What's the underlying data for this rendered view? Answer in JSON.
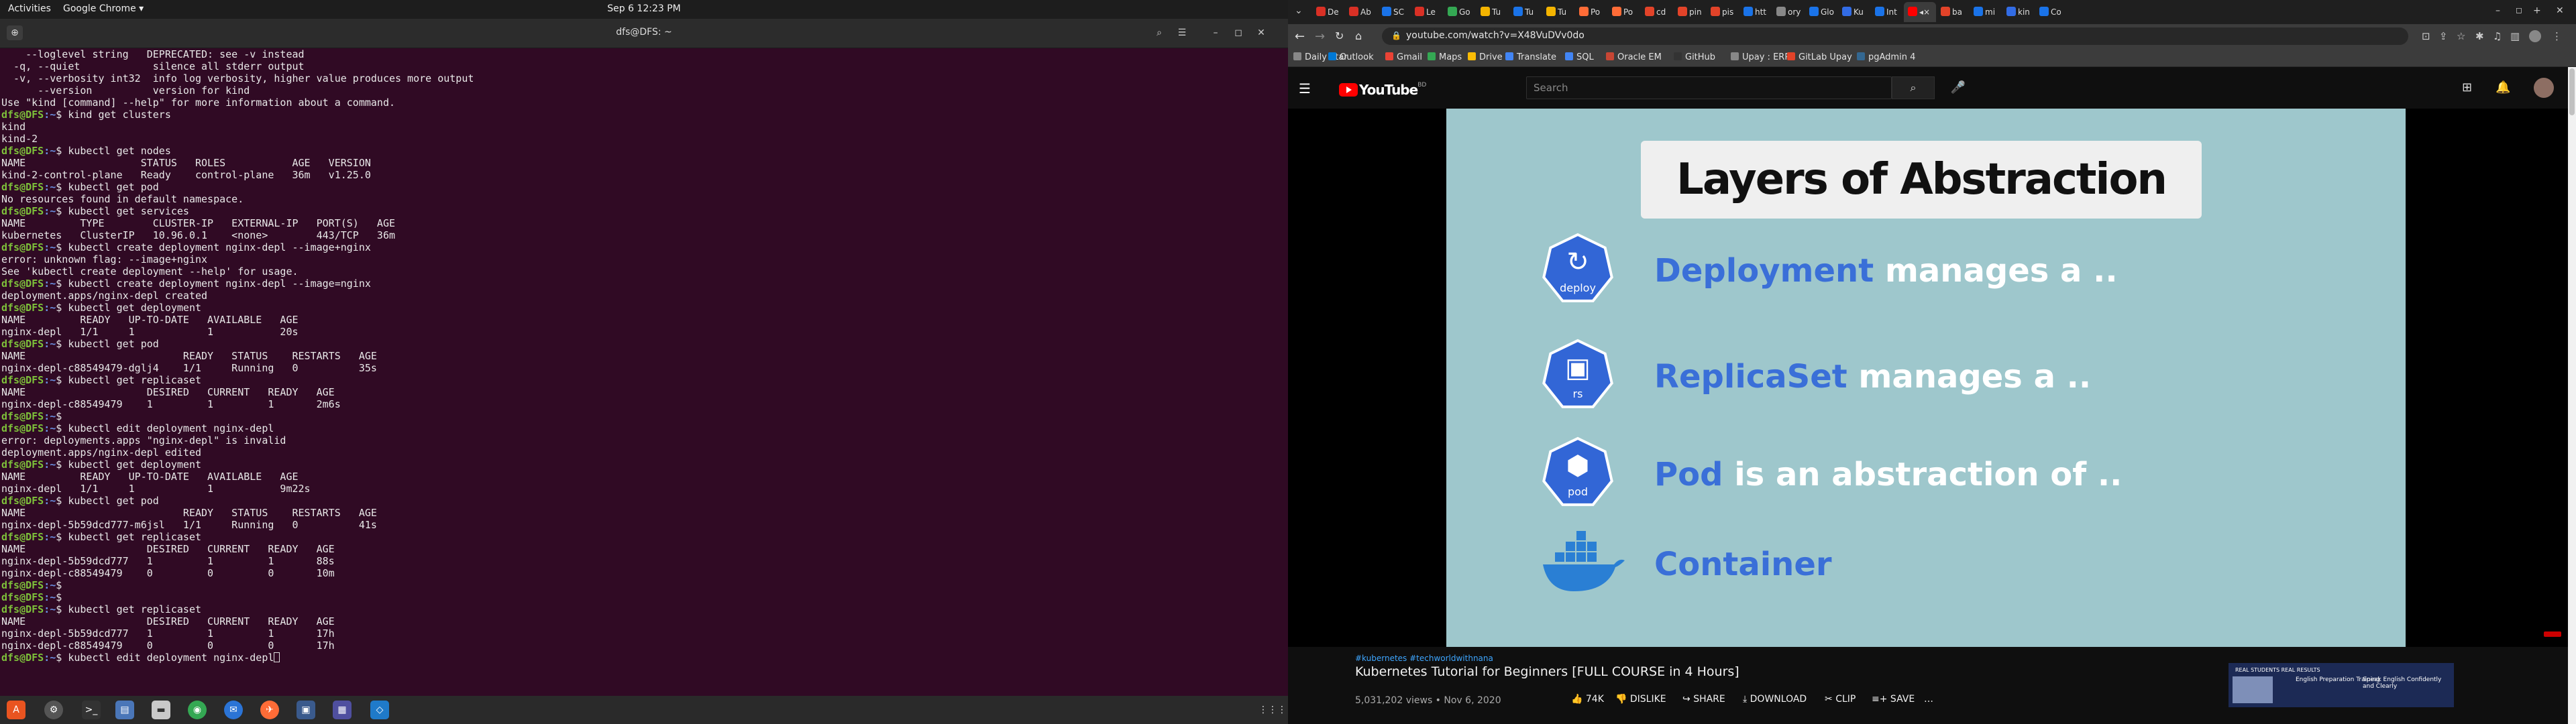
{
  "topbar": {
    "activities": "Activities",
    "app_menu": "Google Chrome ▾",
    "clock": "Sep 6  12:23 PM"
  },
  "terminal": {
    "title": "dfs@DFS: ~",
    "lines": [
      {
        "t": "    --loglevel string   DEPRECATED: see -v instead"
      },
      {
        "t": "  -q, --quiet            silence all stderr output"
      },
      {
        "t": "  -v, --verbosity int32  info log verbosity, higher value produces more output"
      },
      {
        "t": "      --version          version for kind"
      },
      {
        "t": ""
      },
      {
        "t": "Use \"kind [command] --help\" for more information about a command."
      },
      {
        "p": "dfs@DFS",
        "d": ":~",
        "c": "$ kind get clusters"
      },
      {
        "t": "kind"
      },
      {
        "t": "kind-2"
      },
      {
        "p": "dfs@DFS",
        "d": ":~",
        "c": "$ kubectl get nodes"
      },
      {
        "t": "NAME                   STATUS   ROLES           AGE   VERSION"
      },
      {
        "t": "kind-2-control-plane   Ready    control-plane   36m   v1.25.0"
      },
      {
        "p": "dfs@DFS",
        "d": ":~",
        "c": "$ kubectl get pod"
      },
      {
        "t": "No resources found in default namespace."
      },
      {
        "p": "dfs@DFS",
        "d": ":~",
        "c": "$ kubectl get services"
      },
      {
        "t": "NAME         TYPE        CLUSTER-IP   EXTERNAL-IP   PORT(S)   AGE"
      },
      {
        "t": "kubernetes   ClusterIP   10.96.0.1    <none>        443/TCP   36m"
      },
      {
        "p": "dfs@DFS",
        "d": ":~",
        "c": "$ kubectl create deployment nginx-depl --image+nginx"
      },
      {
        "t": "error: unknown flag: --image+nginx"
      },
      {
        "t": "See 'kubectl create deployment --help' for usage."
      },
      {
        "p": "dfs@DFS",
        "d": ":~",
        "c": "$ kubectl create deployment nginx-depl --image=nginx"
      },
      {
        "t": "deployment.apps/nginx-depl created"
      },
      {
        "p": "dfs@DFS",
        "d": ":~",
        "c": "$ kubectl get deployment"
      },
      {
        "t": "NAME         READY   UP-TO-DATE   AVAILABLE   AGE"
      },
      {
        "t": "nginx-depl   1/1     1            1           20s"
      },
      {
        "p": "dfs@DFS",
        "d": ":~",
        "c": "$ kubectl get pod"
      },
      {
        "t": "NAME                          READY   STATUS    RESTARTS   AGE"
      },
      {
        "t": "nginx-depl-c88549479-dglj4    1/1     Running   0          35s"
      },
      {
        "p": "dfs@DFS",
        "d": ":~",
        "c": "$ kubectl get replicaset"
      },
      {
        "t": "NAME                    DESIRED   CURRENT   READY   AGE"
      },
      {
        "t": "nginx-depl-c88549479    1         1         1       2m6s"
      },
      {
        "p": "dfs@DFS",
        "d": ":~",
        "c": "$"
      },
      {
        "p": "dfs@DFS",
        "d": ":~",
        "c": "$ kubectl edit deployment nginx-depl"
      },
      {
        "t": "error: deployments.apps \"nginx-depl\" is invalid"
      },
      {
        "t": "deployment.apps/nginx-depl edited"
      },
      {
        "p": "dfs@DFS",
        "d": ":~",
        "c": "$ kubectl get deployment"
      },
      {
        "t": "NAME         READY   UP-TO-DATE   AVAILABLE   AGE"
      },
      {
        "t": "nginx-depl   1/1     1            1           9m22s"
      },
      {
        "p": "dfs@DFS",
        "d": ":~",
        "c": "$ kubectl get pod"
      },
      {
        "t": "NAME                          READY   STATUS    RESTARTS   AGE"
      },
      {
        "t": "nginx-depl-5b59dcd777-m6jsl   1/1     Running   0          41s"
      },
      {
        "p": "dfs@DFS",
        "d": ":~",
        "c": "$ kubectl get replicaset"
      },
      {
        "t": "NAME                    DESIRED   CURRENT   READY   AGE"
      },
      {
        "t": "nginx-depl-5b59dcd777   1         1         1       88s"
      },
      {
        "t": "nginx-depl-c88549479    0         0         0       10m"
      },
      {
        "p": "dfs@DFS",
        "d": ":~",
        "c": "$"
      },
      {
        "p": "dfs@DFS",
        "d": ":~",
        "c": "$"
      },
      {
        "p": "dfs@DFS",
        "d": ":~",
        "c": "$ kubectl get replicaset"
      },
      {
        "t": "NAME                    DESIRED   CURRENT   READY   AGE"
      },
      {
        "t": "nginx-depl-5b59dcd777   1         1         1       17h"
      },
      {
        "t": "nginx-depl-c88549479    0         0         0       17h"
      },
      {
        "p": "dfs@DFS",
        "d": ":~",
        "c": "$ kubectl edit deployment nginx-depl",
        "cursor": true
      }
    ]
  },
  "dock": {
    "icons": [
      "ubuntu-software-icon",
      "settings-icon",
      "terminal-icon",
      "files-icon",
      "folder-icon",
      "chrome-icon",
      "thunderbird-icon",
      "postman-icon",
      "screenshot-icon",
      "rdp-icon",
      "vscode-icon"
    ],
    "apps_grid": "⋮⋮⋮"
  },
  "chrome": {
    "tabs": [
      {
        "label": "De",
        "color": "#d93025"
      },
      {
        "label": "Ab",
        "color": "#d93025"
      },
      {
        "label": "SC",
        "color": "#1a73e8"
      },
      {
        "label": "Le",
        "color": "#d93025"
      },
      {
        "label": "Go",
        "color": "#34a853"
      },
      {
        "label": "Tu",
        "color": "#f4b400"
      },
      {
        "label": "Tu",
        "color": "#1a73e8"
      },
      {
        "label": "Tu",
        "color": "#f4b400"
      },
      {
        "label": "Po",
        "color": "#ff6c37"
      },
      {
        "label": "Po",
        "color": "#ff6c37"
      },
      {
        "label": "cd",
        "color": "#e24329"
      },
      {
        "label": "pin",
        "color": "#e24329"
      },
      {
        "label": "pis",
        "color": "#e24329"
      },
      {
        "label": "htt",
        "color": "#1a73e8"
      },
      {
        "label": "ory",
        "color": "#888888"
      },
      {
        "label": "Glo",
        "color": "#1a73e8"
      },
      {
        "label": "Ku",
        "color": "#326ce5"
      },
      {
        "label": "Int",
        "color": "#1a73e8"
      },
      {
        "label": "◂×",
        "color": "#ff0000",
        "active": true
      },
      {
        "label": "ba",
        "color": "#e24329"
      },
      {
        "label": "mi",
        "color": "#1a73e8"
      },
      {
        "label": "kin",
        "color": "#326ce5"
      },
      {
        "label": "Co",
        "color": "#1a73e8"
      }
    ],
    "new_tab": "+",
    "address": "youtube.com/watch?v=X48VuDVv0do",
    "bookmarks": [
      {
        "label": "Daily Star",
        "color": "#888888"
      },
      {
        "label": "Outlook",
        "color": "#0078d4"
      },
      {
        "label": "Gmail",
        "color": "#ea4335"
      },
      {
        "label": "Maps",
        "color": "#34a853"
      },
      {
        "label": "Drive",
        "color": "#fbbc05"
      },
      {
        "label": "Translate",
        "color": "#4285f4"
      },
      {
        "label": "SQL",
        "color": "#4285f4"
      },
      {
        "label": "Oracle EM",
        "color": "#c74634"
      },
      {
        "label": "GitHub",
        "color": "#333333"
      },
      {
        "label": "Upay : ERP",
        "color": "#888888"
      },
      {
        "label": "GitLab Upay",
        "color": "#e24329"
      },
      {
        "label": "pgAdmin 4",
        "color": "#336791"
      }
    ]
  },
  "youtube": {
    "logo": "YouTube",
    "logo_country": "BD",
    "search_placeholder": "Search",
    "slide": {
      "title": "Layers of Abstraction",
      "rows": [
        {
          "key": "Deployment",
          "rest": " manages a ..",
          "icon_label": "deploy"
        },
        {
          "key": "ReplicaSet",
          "rest": " manages a ..",
          "icon_label": "rs"
        },
        {
          "key": "Pod",
          "rest": " is an abstraction of ..",
          "icon_label": "pod"
        },
        {
          "key": "Container",
          "rest": "",
          "icon_label": ""
        }
      ]
    },
    "tags": "#kubernetes #techworldwithnana",
    "video_title": "Kubernetes Tutorial for Beginners [FULL COURSE in 4 Hours]",
    "meta": "5,031,202 views • Nov 6, 2020",
    "actions": {
      "like": "74K",
      "dislike": "DISLIKE",
      "share": "SHARE",
      "download": "DOWNLOAD",
      "clip": "CLIP",
      "save": "SAVE",
      "more": "…"
    },
    "ad": {
      "header": "REAL STUDENTS REAL RESULTS",
      "cell1": "English Preparation Training",
      "cell2": "Speak English Confidently and Clearly"
    }
  }
}
